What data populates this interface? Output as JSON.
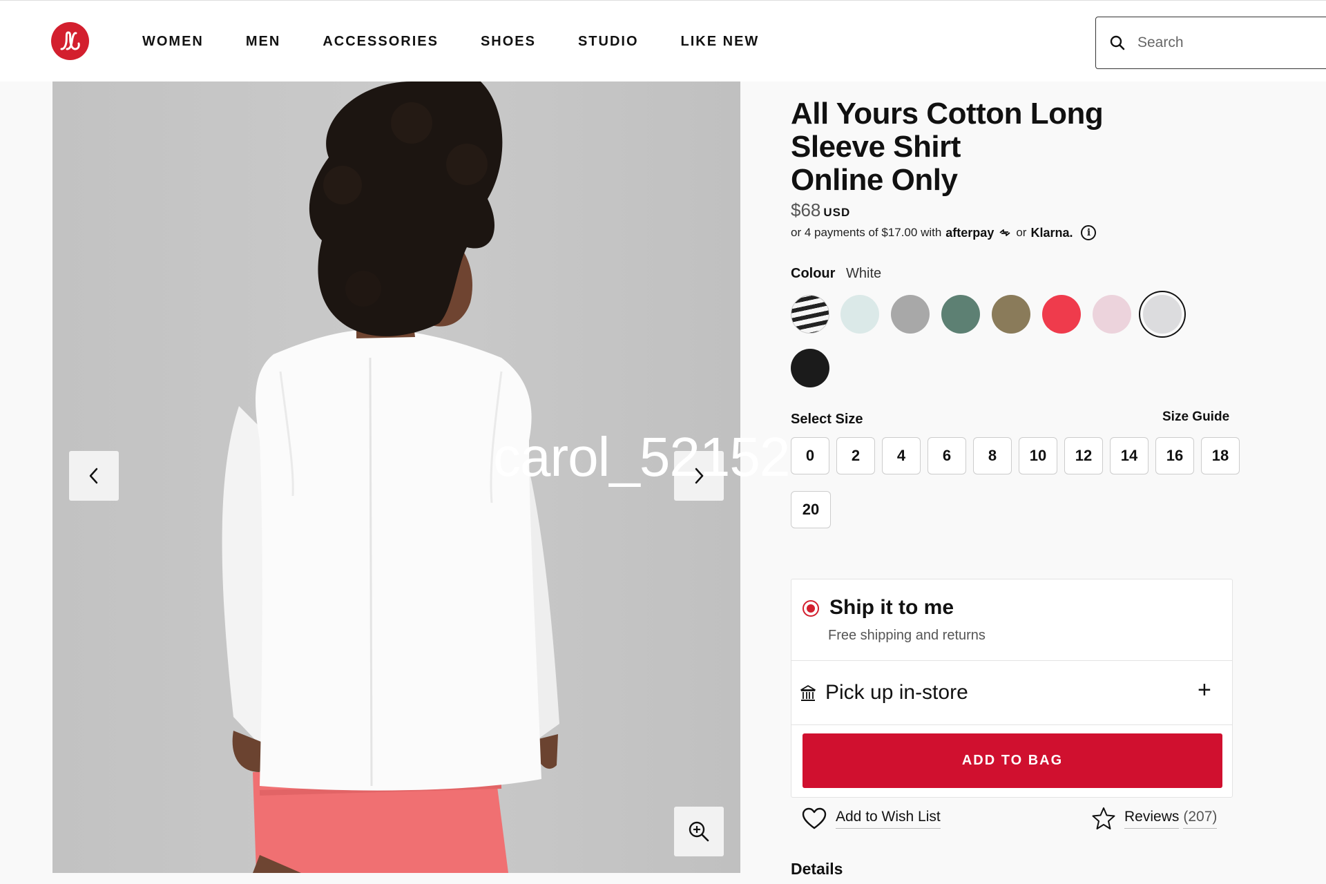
{
  "header": {
    "nav": [
      "WOMEN",
      "MEN",
      "ACCESSORIES",
      "SHOES",
      "STUDIO",
      "LIKE NEW"
    ],
    "search_placeholder": "Search"
  },
  "gallery": {
    "watermark": "carol_52152"
  },
  "product": {
    "title_lines": [
      "All Yours Cotton Long",
      "Sleeve Shirt",
      "Online Only"
    ],
    "price": "$68",
    "currency": "USD",
    "installments": {
      "prefix": "or 4 payments of $17.00 with",
      "afterpay": "afterpay",
      "or": "or",
      "klarna": "Klarna."
    },
    "colour_label": "Colour",
    "colour_value": "White",
    "swatches": [
      {
        "name": "stripe",
        "color": "#222222"
      },
      {
        "name": "light-aqua",
        "color": "#dbe9e8"
      },
      {
        "name": "heathered-grey",
        "color": "#a8a8a8"
      },
      {
        "name": "sage-green",
        "color": "#5d8073"
      },
      {
        "name": "olive",
        "color": "#8a7b5a"
      },
      {
        "name": "red",
        "color": "#ef3b4c"
      },
      {
        "name": "pink-mist",
        "color": "#ecd3dc"
      },
      {
        "name": "white",
        "color": "#dcdcde",
        "selected": true
      },
      {
        "name": "black",
        "color": "#1b1b1b"
      }
    ],
    "size_label": "Select Size",
    "size_guide": "Size Guide",
    "sizes": [
      "0",
      "2",
      "4",
      "6",
      "8",
      "10",
      "12",
      "14",
      "16",
      "18",
      "20"
    ]
  },
  "purchase": {
    "ship_title": "Ship it to me",
    "ship_subtitle": "Free shipping and returns",
    "pickup_label": "Pick up in-store",
    "pickup_toggle": "+",
    "add_to_bag": "ADD TO BAG",
    "wishlist": "Add to Wish List",
    "reviews_label": "Reviews",
    "reviews_count": "(207)"
  },
  "details_heading": "Details",
  "colors": {
    "brand_red": "#d31f2e",
    "cta_red": "#d0102f"
  }
}
